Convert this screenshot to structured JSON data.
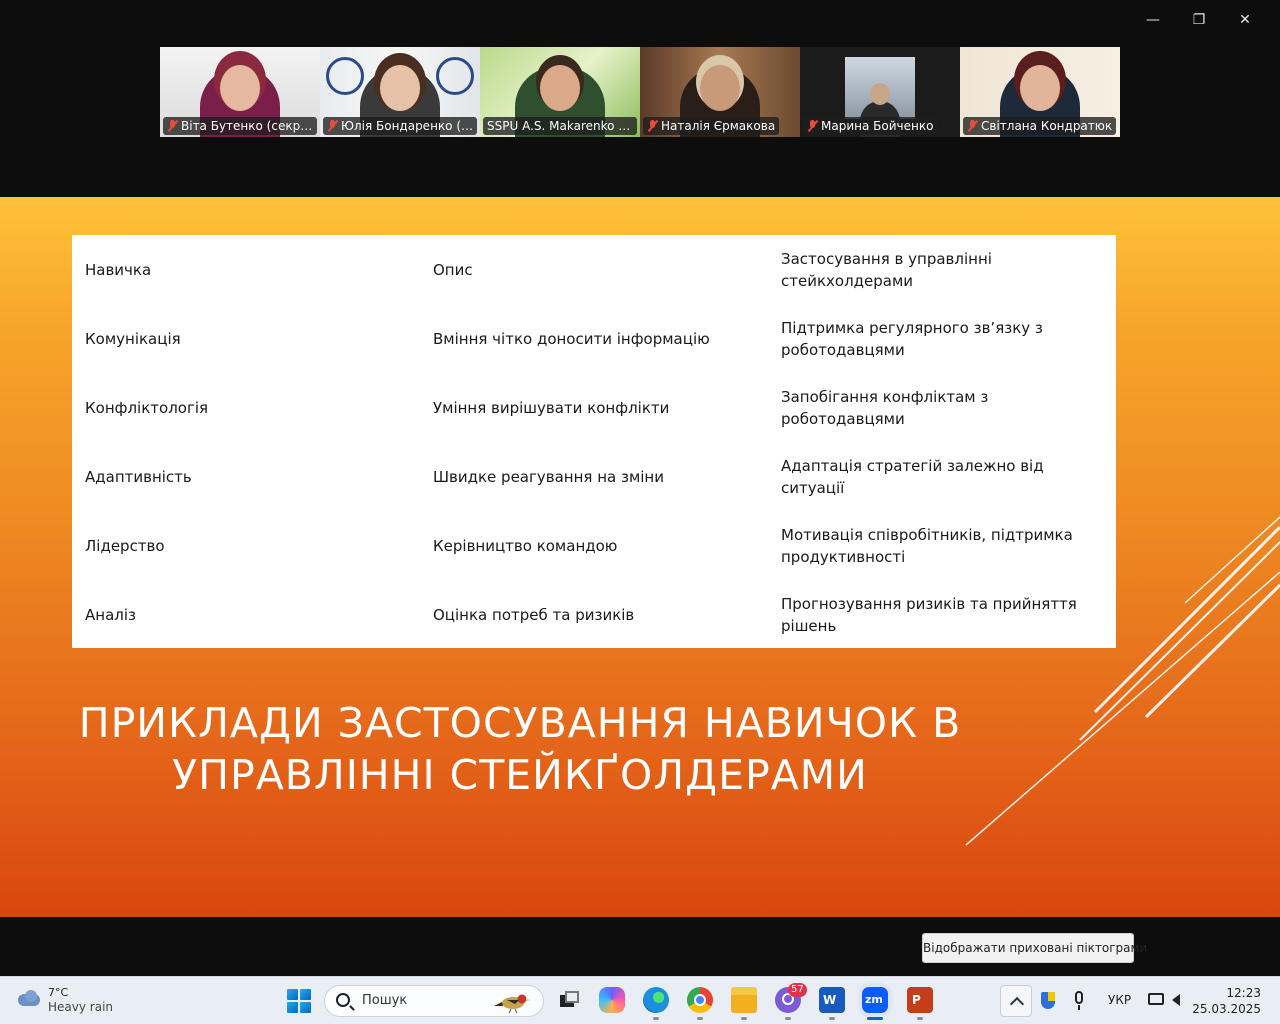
{
  "window": {
    "minimize_glyph": "—",
    "restore_glyph": "❐",
    "close_glyph": "✕"
  },
  "participants": [
    {
      "name": "Віта Бутенко (секретар...",
      "muted": true,
      "active": false
    },
    {
      "name": "Юлія Бондаренко (гара...",
      "muted": true,
      "active": false
    },
    {
      "name": "SSPU A.S. Makarenko Se...",
      "muted": false,
      "active": true
    },
    {
      "name": "Наталія  Єрмакова",
      "muted": true,
      "active": false
    },
    {
      "name": "Марина Бойченко",
      "muted": true,
      "active": false
    },
    {
      "name": "Світлана Кондратюк",
      "muted": true,
      "active": false
    }
  ],
  "slide": {
    "table": {
      "headers": [
        "Навичка",
        "Опис",
        "Застосування в управлінні стейкхолдерами"
      ],
      "rows": [
        [
          "Комунікація",
          "Вміння чітко доносити інформацію",
          "Підтримка регулярного зв’язку з роботодавцями"
        ],
        [
          "Конфліктологія",
          "Уміння вирішувати конфлікти",
          "Запобігання конфліктам з роботодавцями"
        ],
        [
          "Адаптивність",
          "Швидке реагування на зміни",
          "Адаптація стратегій залежно від ситуації"
        ],
        [
          "Лідерство",
          "Керівництво командою",
          "Мотивація співробітників, підтримка продуктивності"
        ],
        [
          "Аналіз",
          "Оцінка потреб та ризиків",
          "Прогнозування ризиків та прийняття рішень"
        ]
      ]
    },
    "title_line1": "ПРИКЛАДИ ЗАСТОСУВАННЯ НАВИЧОК В",
    "title_line2": "УПРАВЛІННІ СТЕЙКҐОЛДЕРАМИ"
  },
  "tooltip": "Відображати приховані піктограми",
  "taskbar": {
    "weather_temp": "7°C",
    "weather_cond": "Heavy rain",
    "search_placeholder": "Пошук",
    "viber_badge": "57",
    "language": "УКР",
    "time": "12:23",
    "date": "25.03.2025"
  },
  "colors": {
    "active_speaker": "#2ecc71",
    "slide_top": "#ffc23a",
    "slide_bottom": "#d9460e"
  }
}
